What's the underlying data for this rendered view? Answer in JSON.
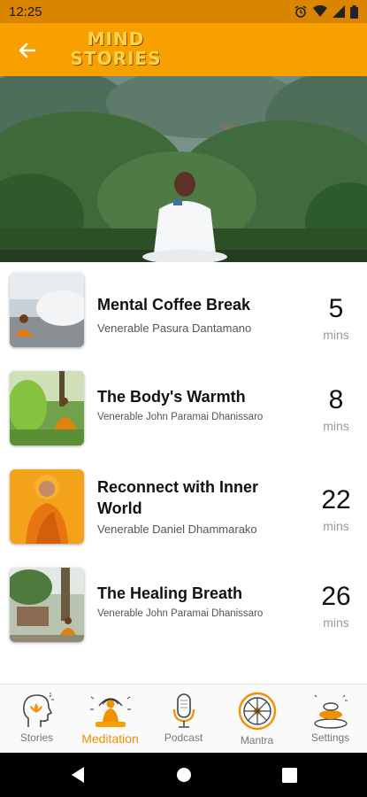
{
  "status_bar": {
    "time": "12:25",
    "icons": [
      "alarm-icon",
      "wifi-icon",
      "signal-icon",
      "battery-icon"
    ]
  },
  "app_bar": {
    "back_icon": "arrow-left-icon",
    "logo_line1": "MIND",
    "logo_line2": "STORIES"
  },
  "colors": {
    "accent": "#f7a000",
    "status": "#d98500",
    "active_tab": "#f29100"
  },
  "sessions": [
    {
      "title": "Mental Coffee Break",
      "teacher": "Venerable Pasura Dantamano",
      "duration": "5",
      "unit": "mins"
    },
    {
      "title": "The Body's Warmth",
      "teacher": "Venerable John Paramai Dhanissaro",
      "duration": "8",
      "unit": "mins"
    },
    {
      "title": "Reconnect with Inner World",
      "teacher": "Venerable Daniel Dhammarako",
      "duration": "22",
      "unit": "mins"
    },
    {
      "title": "The Healing Breath",
      "teacher": "Venerable John Paramai Dhanissaro",
      "duration": "26",
      "unit": "mins"
    }
  ],
  "tabs": [
    {
      "label": "Stories",
      "icon": "head-lotus-icon"
    },
    {
      "label": "Meditation",
      "icon": "meditator-icon",
      "active": true
    },
    {
      "label": "Podcast",
      "icon": "microphone-icon"
    },
    {
      "label": "Mantra",
      "icon": "dharma-wheel-icon"
    },
    {
      "label": "Settings",
      "icon": "stones-icon"
    }
  ]
}
